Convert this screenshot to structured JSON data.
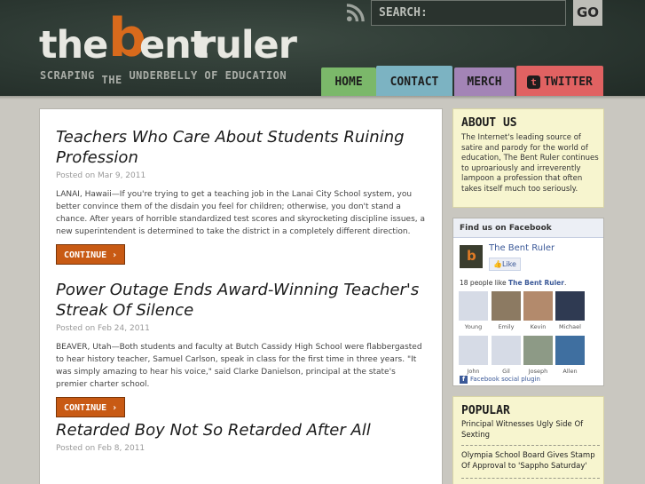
{
  "header": {
    "logo": {
      "the": "the",
      "b": "b",
      "ent": "ent",
      "ruler": "ruler"
    },
    "tagline_1": "SCRAPING",
    "tagline_2": "THE",
    "tagline_3": "UNDERBELLY OF EDUCATION",
    "search_label": "SEARCH:",
    "go_label": "GO"
  },
  "nav": {
    "home": "HOME",
    "contact": "CONTACT",
    "merch": "MERCH",
    "twitter": "TWITTER"
  },
  "posts": [
    {
      "title": "Teachers Who Care About Students Ruining Profession",
      "date": "Posted on Mar 9, 2011",
      "excerpt": "LANAI, Hawaii—If you're trying to get a teaching job in the Lanai City School system, you better convince them of the disdain you feel for children; otherwise, you don't stand a chance. After years of horrible standardized test scores and skyrocketing discipline issues, a new superintendent is determined to take the district in a completely different direction.",
      "button": "CONTINUE ›"
    },
    {
      "title": "Power Outage Ends Award-Winning Teacher's Streak Of Silence",
      "date": "Posted on Feb 24, 2011",
      "excerpt": "BEAVER, Utah—Both students and faculty at Butch Cassidy High School were flabbergasted to hear history teacher, Samuel Carlson, speak in class for the first time in three years. \"It was simply amazing to hear his voice,\" said Clarke Danielson, principal at the state's premier charter school.",
      "button": "CONTINUE ›"
    },
    {
      "title": "Retarded Boy Not So Retarded After All",
      "date": "Posted on Feb 8, 2011",
      "excerpt": ""
    }
  ],
  "sidebar": {
    "about": {
      "title": "ABOUT US",
      "text": "The Internet's leading source of satire and parody for the world of education, The Bent Ruler continues to uproariously and irreverently lampoon a profession that often takes itself much too seriously."
    },
    "facebook": {
      "title": "Find us on Facebook",
      "page_name": "The Bent Ruler",
      "like_label": "Like",
      "count_prefix": "18 people like",
      "count_name": "The Bent Ruler",
      "count_suffix": ".",
      "fans": [
        "Young",
        "Emily",
        "Kevin",
        "Michael",
        "John",
        "Gil",
        "Joseph",
        "Allen"
      ],
      "plugin_label": "Facebook social plugin"
    },
    "popular": {
      "title": "POPULAR",
      "items": [
        "Principal Witnesses Ugly Side Of Sexting",
        "Olympia School Board Gives Stamp Of Approval to 'Sappho Saturday'"
      ]
    }
  }
}
